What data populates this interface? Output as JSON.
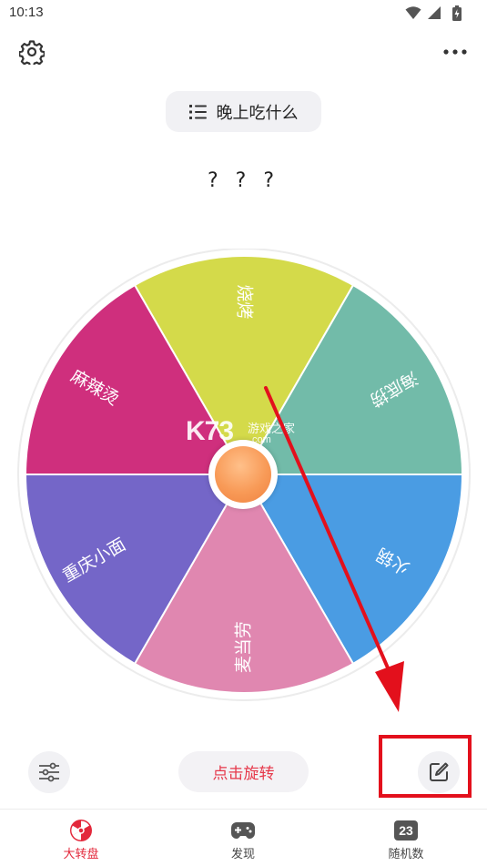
{
  "status_bar": {
    "time": "10:13"
  },
  "wheel": {
    "title": "晚上吃什么",
    "result": "? ? ?",
    "options": [
      {
        "label": "烧烤",
        "color": "#d4da4a"
      },
      {
        "label": "海底捞",
        "color": "#72bba9"
      },
      {
        "label": "火锅",
        "color": "#4a9ce3"
      },
      {
        "label": "麦当劳",
        "color": "#e087b0"
      },
      {
        "label": "重庆小面",
        "color": "#7466c8"
      },
      {
        "label": "麻辣烫",
        "color": "#cf2f7d"
      }
    ]
  },
  "watermark": {
    "logo": "K73",
    "cn": "游戏之家",
    "en": ".com"
  },
  "actions": {
    "spin_label": "点击旋转"
  },
  "bottom_nav": [
    {
      "label": "大转盘",
      "icon": "wheel-nav-icon",
      "active": true
    },
    {
      "label": "发现",
      "icon": "gamepad-icon",
      "active": false
    },
    {
      "label": "随机数",
      "icon": "number-23-icon",
      "badge": "23",
      "active": false
    }
  ],
  "colors": {
    "accent": "#e3283b",
    "annotation_red": "#e3101c"
  }
}
